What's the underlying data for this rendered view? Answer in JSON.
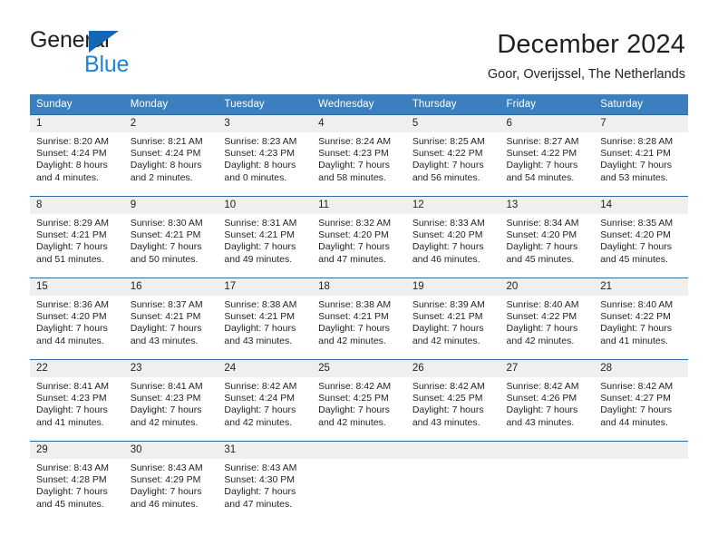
{
  "brand": {
    "name_top": "General",
    "name_bottom": "Blue",
    "accent_color": "#1f84d6",
    "triangle_color": "#1567b3"
  },
  "header": {
    "title": "December 2024",
    "subtitle": "Goor, Overijssel, The Netherlands"
  },
  "theme": {
    "header_row_bg": "#3c7fbe",
    "header_row_text": "#ffffff",
    "row_divider": "#2e6da4",
    "daynum_bg": "#efefef",
    "text": "#231f20"
  },
  "calendar": {
    "weekday_headers": [
      "Sunday",
      "Monday",
      "Tuesday",
      "Wednesday",
      "Thursday",
      "Friday",
      "Saturday"
    ],
    "weeks": [
      [
        {
          "day": "1",
          "sunrise": "Sunrise: 8:20 AM",
          "sunset": "Sunset: 4:24 PM",
          "daylight_line1": "Daylight: 8 hours",
          "daylight_line2": "and 4 minutes."
        },
        {
          "day": "2",
          "sunrise": "Sunrise: 8:21 AM",
          "sunset": "Sunset: 4:24 PM",
          "daylight_line1": "Daylight: 8 hours",
          "daylight_line2": "and 2 minutes."
        },
        {
          "day": "3",
          "sunrise": "Sunrise: 8:23 AM",
          "sunset": "Sunset: 4:23 PM",
          "daylight_line1": "Daylight: 8 hours",
          "daylight_line2": "and 0 minutes."
        },
        {
          "day": "4",
          "sunrise": "Sunrise: 8:24 AM",
          "sunset": "Sunset: 4:23 PM",
          "daylight_line1": "Daylight: 7 hours",
          "daylight_line2": "and 58 minutes."
        },
        {
          "day": "5",
          "sunrise": "Sunrise: 8:25 AM",
          "sunset": "Sunset: 4:22 PM",
          "daylight_line1": "Daylight: 7 hours",
          "daylight_line2": "and 56 minutes."
        },
        {
          "day": "6",
          "sunrise": "Sunrise: 8:27 AM",
          "sunset": "Sunset: 4:22 PM",
          "daylight_line1": "Daylight: 7 hours",
          "daylight_line2": "and 54 minutes."
        },
        {
          "day": "7",
          "sunrise": "Sunrise: 8:28 AM",
          "sunset": "Sunset: 4:21 PM",
          "daylight_line1": "Daylight: 7 hours",
          "daylight_line2": "and 53 minutes."
        }
      ],
      [
        {
          "day": "8",
          "sunrise": "Sunrise: 8:29 AM",
          "sunset": "Sunset: 4:21 PM",
          "daylight_line1": "Daylight: 7 hours",
          "daylight_line2": "and 51 minutes."
        },
        {
          "day": "9",
          "sunrise": "Sunrise: 8:30 AM",
          "sunset": "Sunset: 4:21 PM",
          "daylight_line1": "Daylight: 7 hours",
          "daylight_line2": "and 50 minutes."
        },
        {
          "day": "10",
          "sunrise": "Sunrise: 8:31 AM",
          "sunset": "Sunset: 4:21 PM",
          "daylight_line1": "Daylight: 7 hours",
          "daylight_line2": "and 49 minutes."
        },
        {
          "day": "11",
          "sunrise": "Sunrise: 8:32 AM",
          "sunset": "Sunset: 4:20 PM",
          "daylight_line1": "Daylight: 7 hours",
          "daylight_line2": "and 47 minutes."
        },
        {
          "day": "12",
          "sunrise": "Sunrise: 8:33 AM",
          "sunset": "Sunset: 4:20 PM",
          "daylight_line1": "Daylight: 7 hours",
          "daylight_line2": "and 46 minutes."
        },
        {
          "day": "13",
          "sunrise": "Sunrise: 8:34 AM",
          "sunset": "Sunset: 4:20 PM",
          "daylight_line1": "Daylight: 7 hours",
          "daylight_line2": "and 45 minutes."
        },
        {
          "day": "14",
          "sunrise": "Sunrise: 8:35 AM",
          "sunset": "Sunset: 4:20 PM",
          "daylight_line1": "Daylight: 7 hours",
          "daylight_line2": "and 45 minutes."
        }
      ],
      [
        {
          "day": "15",
          "sunrise": "Sunrise: 8:36 AM",
          "sunset": "Sunset: 4:20 PM",
          "daylight_line1": "Daylight: 7 hours",
          "daylight_line2": "and 44 minutes."
        },
        {
          "day": "16",
          "sunrise": "Sunrise: 8:37 AM",
          "sunset": "Sunset: 4:21 PM",
          "daylight_line1": "Daylight: 7 hours",
          "daylight_line2": "and 43 minutes."
        },
        {
          "day": "17",
          "sunrise": "Sunrise: 8:38 AM",
          "sunset": "Sunset: 4:21 PM",
          "daylight_line1": "Daylight: 7 hours",
          "daylight_line2": "and 43 minutes."
        },
        {
          "day": "18",
          "sunrise": "Sunrise: 8:38 AM",
          "sunset": "Sunset: 4:21 PM",
          "daylight_line1": "Daylight: 7 hours",
          "daylight_line2": "and 42 minutes."
        },
        {
          "day": "19",
          "sunrise": "Sunrise: 8:39 AM",
          "sunset": "Sunset: 4:21 PM",
          "daylight_line1": "Daylight: 7 hours",
          "daylight_line2": "and 42 minutes."
        },
        {
          "day": "20",
          "sunrise": "Sunrise: 8:40 AM",
          "sunset": "Sunset: 4:22 PM",
          "daylight_line1": "Daylight: 7 hours",
          "daylight_line2": "and 42 minutes."
        },
        {
          "day": "21",
          "sunrise": "Sunrise: 8:40 AM",
          "sunset": "Sunset: 4:22 PM",
          "daylight_line1": "Daylight: 7 hours",
          "daylight_line2": "and 41 minutes."
        }
      ],
      [
        {
          "day": "22",
          "sunrise": "Sunrise: 8:41 AM",
          "sunset": "Sunset: 4:23 PM",
          "daylight_line1": "Daylight: 7 hours",
          "daylight_line2": "and 41 minutes."
        },
        {
          "day": "23",
          "sunrise": "Sunrise: 8:41 AM",
          "sunset": "Sunset: 4:23 PM",
          "daylight_line1": "Daylight: 7 hours",
          "daylight_line2": "and 42 minutes."
        },
        {
          "day": "24",
          "sunrise": "Sunrise: 8:42 AM",
          "sunset": "Sunset: 4:24 PM",
          "daylight_line1": "Daylight: 7 hours",
          "daylight_line2": "and 42 minutes."
        },
        {
          "day": "25",
          "sunrise": "Sunrise: 8:42 AM",
          "sunset": "Sunset: 4:25 PM",
          "daylight_line1": "Daylight: 7 hours",
          "daylight_line2": "and 42 minutes."
        },
        {
          "day": "26",
          "sunrise": "Sunrise: 8:42 AM",
          "sunset": "Sunset: 4:25 PM",
          "daylight_line1": "Daylight: 7 hours",
          "daylight_line2": "and 43 minutes."
        },
        {
          "day": "27",
          "sunrise": "Sunrise: 8:42 AM",
          "sunset": "Sunset: 4:26 PM",
          "daylight_line1": "Daylight: 7 hours",
          "daylight_line2": "and 43 minutes."
        },
        {
          "day": "28",
          "sunrise": "Sunrise: 8:42 AM",
          "sunset": "Sunset: 4:27 PM",
          "daylight_line1": "Daylight: 7 hours",
          "daylight_line2": "and 44 minutes."
        }
      ],
      [
        {
          "day": "29",
          "sunrise": "Sunrise: 8:43 AM",
          "sunset": "Sunset: 4:28 PM",
          "daylight_line1": "Daylight: 7 hours",
          "daylight_line2": "and 45 minutes."
        },
        {
          "day": "30",
          "sunrise": "Sunrise: 8:43 AM",
          "sunset": "Sunset: 4:29 PM",
          "daylight_line1": "Daylight: 7 hours",
          "daylight_line2": "and 46 minutes."
        },
        {
          "day": "31",
          "sunrise": "Sunrise: 8:43 AM",
          "sunset": "Sunset: 4:30 PM",
          "daylight_line1": "Daylight: 7 hours",
          "daylight_line2": "and 47 minutes."
        },
        {
          "day": "",
          "sunrise": "",
          "sunset": "",
          "daylight_line1": "",
          "daylight_line2": ""
        },
        {
          "day": "",
          "sunrise": "",
          "sunset": "",
          "daylight_line1": "",
          "daylight_line2": ""
        },
        {
          "day": "",
          "sunrise": "",
          "sunset": "",
          "daylight_line1": "",
          "daylight_line2": ""
        },
        {
          "day": "",
          "sunrise": "",
          "sunset": "",
          "daylight_line1": "",
          "daylight_line2": ""
        }
      ]
    ]
  }
}
